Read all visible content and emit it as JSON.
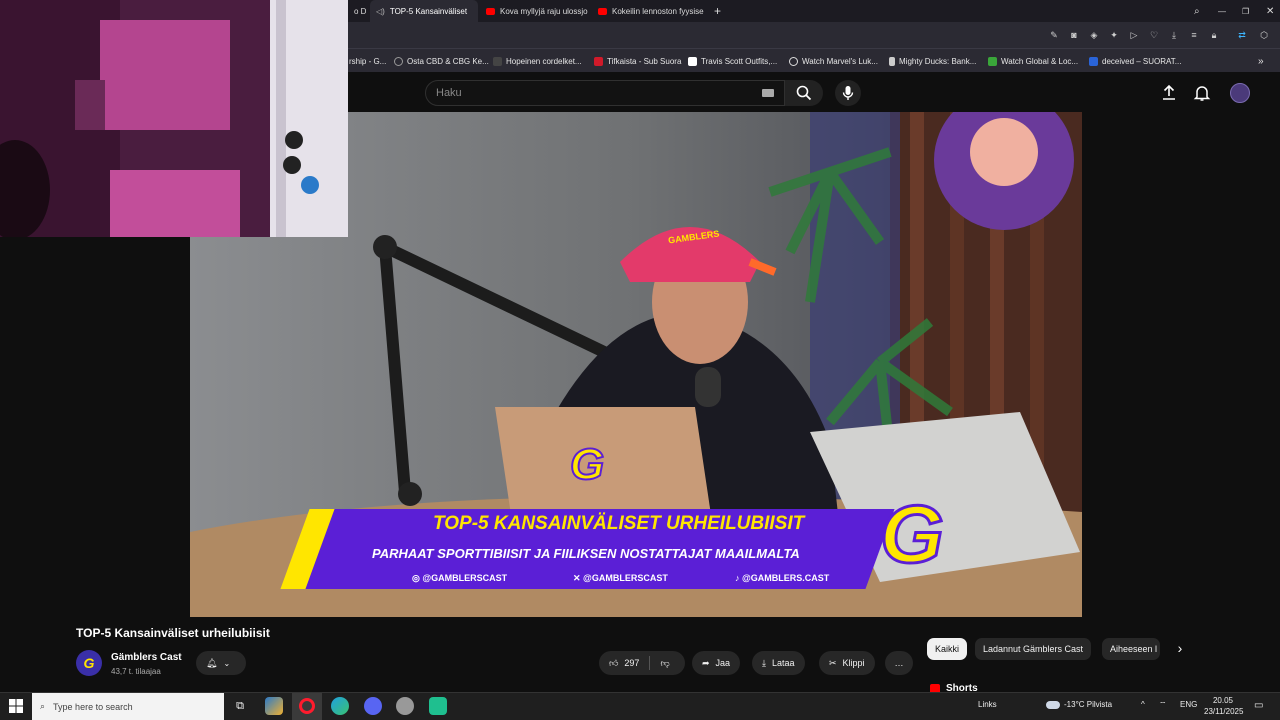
{
  "browser": {
    "tabs": [
      {
        "label": "o Dr",
        "active": false
      },
      {
        "label": "TOP-5 Kansainväliset",
        "active": true
      },
      {
        "label": "Kova myllyjä raju ulossjo",
        "active": false
      },
      {
        "label": "Kokeilin lennoston fyysise",
        "active": false
      }
    ],
    "bookmarks": [
      "rship - G...",
      "Osta CBD & CBG Ke...",
      "Hopeinen cordelket...",
      "Tifkaista - Sub Suora",
      "Travis Scott Outfits,...",
      "Watch Marvel's Luk...",
      "Mighty Ducks: Bank...",
      "Watch Global & Loc...",
      "deceived – SUORAT..."
    ]
  },
  "youtube": {
    "search_placeholder": "Haku",
    "video": {
      "overlay_title": "TOP-5 KANSAINVÄLISET URHEILUBIISIT",
      "overlay_subtitle": "PARHAAT SPORTTIBIISIT JA FIILIKSEN NOSTATTAJAT MAAILMALTA",
      "socials": [
        "@GAMBLERSCAST",
        "@GAMBLERSCAST",
        "@GAMBLERS.CAST"
      ],
      "laptop_logo": "G",
      "cap_text": "GAMBLERS",
      "big_logo": "G"
    },
    "title": "TOP-5 Kansainväliset urheilubiisit",
    "channel": {
      "name": "Gämblers Cast",
      "subscribers": "43,7 t. tilaajaa",
      "avatar_letter": "G"
    },
    "actions": {
      "likes": "297",
      "share": "Jaa",
      "download": "Lataa",
      "clip": "Klippi",
      "more": "…"
    },
    "chips": [
      "Kaikki",
      "Ladannut Gämblers Cast",
      "Aiheeseen l"
    ],
    "shorts_label": "Shorts"
  },
  "taskbar": {
    "search_placeholder": "Type here to search",
    "links": "Links",
    "weather": "-13°C Pilvista",
    "lang": "ENG",
    "time": "20.05",
    "date": "23/11/2025"
  },
  "colors": {
    "banner_purple": "#5b1fd6",
    "banner_yellow": "#ffe600",
    "accent_red": "#ff0000"
  }
}
